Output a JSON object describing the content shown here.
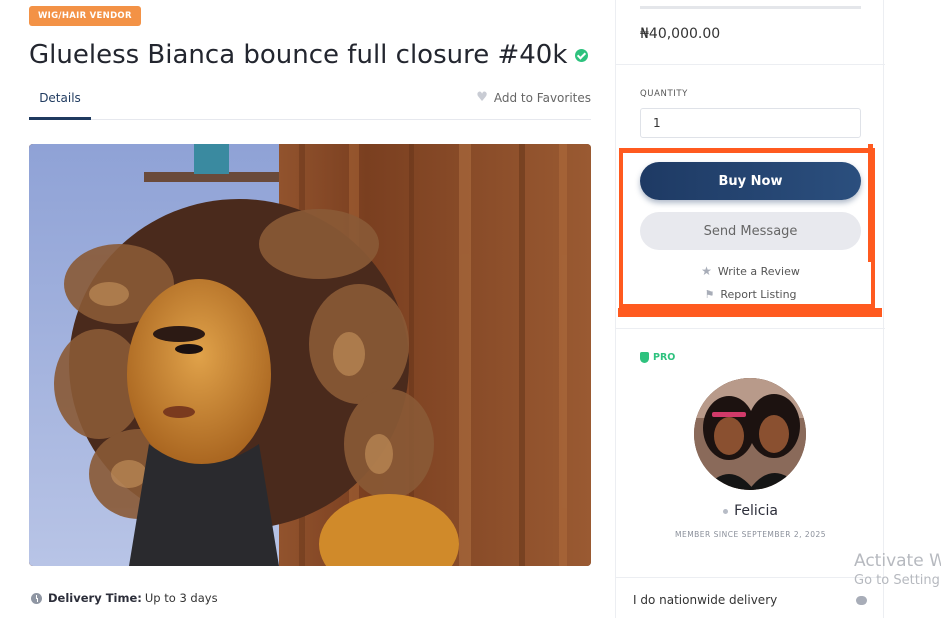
{
  "listing": {
    "category_badge": "WIG/HAIR VENDOR",
    "title": "Glueless Bianca bounce full closure #40k",
    "tabs": [
      {
        "label": "Details",
        "active": true
      }
    ],
    "favorite_label": "Add to Favorites",
    "delivery_label": "Delivery Time:",
    "delivery_value": "Up to 3 days"
  },
  "sidebar": {
    "price": "₦40,000.00",
    "quantity_label": "QUANTITY",
    "quantity_value": "1",
    "buy_label": "Buy Now",
    "message_label": "Send Message",
    "review_label": "Write a Review",
    "report_label": "Report Listing",
    "pro_label": "PRO",
    "vendor_name": "Felicia",
    "member_since": "MEMBER SINCE SEPTEMBER 2, 2025",
    "note": "I do nationwide delivery"
  },
  "overlay": {
    "activate_title": "Activate W",
    "activate_sub": "Go to Setting"
  },
  "icons": {
    "verified": "verified-check-icon",
    "favorite": "heart-icon",
    "review": "star-icon",
    "report": "flag-icon",
    "pro": "shield-icon",
    "delivery": "clock-icon",
    "note": "chat-icon"
  },
  "colors": {
    "badge": "#f39246",
    "primary": "#1e3a64",
    "verified": "#2ec27e",
    "highlight": "#ff5a1f"
  }
}
